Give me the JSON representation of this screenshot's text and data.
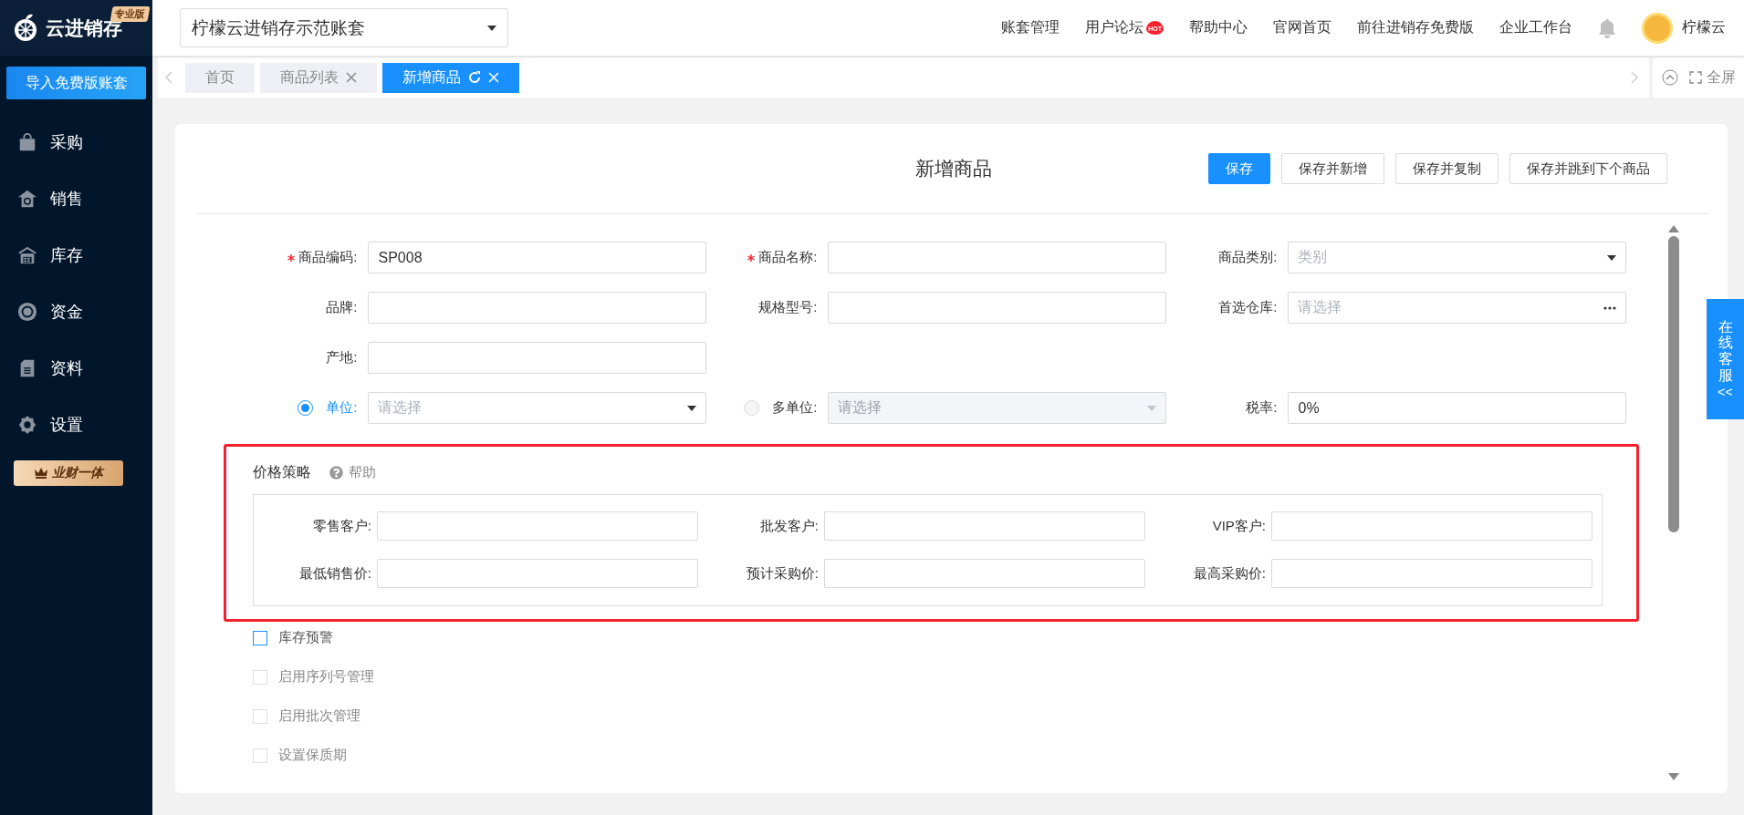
{
  "sidebar": {
    "logo": "云进销存",
    "edition": "专业版",
    "import_button": "导入免费版账套",
    "items": [
      {
        "label": "采购"
      },
      {
        "label": "销售"
      },
      {
        "label": "库存"
      },
      {
        "label": "资金"
      },
      {
        "label": "资料"
      },
      {
        "label": "设置"
      }
    ],
    "promo": "业财一体"
  },
  "header": {
    "account": "柠檬云进销存示范账套",
    "nav": [
      {
        "label": "账套管理"
      },
      {
        "label": "用户论坛",
        "badge": "HOT"
      },
      {
        "label": "帮助中心"
      },
      {
        "label": "官网首页"
      },
      {
        "label": "前往进销存免费版"
      },
      {
        "label": "企业工作台"
      }
    ],
    "user": "柠檬云"
  },
  "tabs": [
    {
      "label": "首页",
      "selected": false,
      "closable": false,
      "refreshable": false
    },
    {
      "label": "商品列表",
      "selected": false,
      "closable": true,
      "refreshable": false
    },
    {
      "label": "新增商品",
      "selected": true,
      "closable": true,
      "refreshable": true
    }
  ],
  "fullscreen": "全屏",
  "form": {
    "title": "新增商品",
    "buttons": [
      {
        "label": "保存",
        "primary": true
      },
      {
        "label": "保存并新增",
        "primary": false
      },
      {
        "label": "保存并复制",
        "primary": false
      },
      {
        "label": "保存并跳到下个商品",
        "primary": false
      }
    ],
    "rows": [
      [
        {
          "kind": "text",
          "label": "商品编码:",
          "required": true,
          "value": "SP008"
        },
        {
          "kind": "text",
          "label": "商品名称:",
          "required": true
        },
        {
          "kind": "select",
          "label": "商品类别:",
          "required": false,
          "placeholder": "类别"
        }
      ],
      [
        {
          "kind": "text",
          "label": "品牌:",
          "required": false
        },
        {
          "kind": "text",
          "label": "规格型号:",
          "required": false
        },
        {
          "kind": "picker",
          "label": "首选仓库:",
          "required": false,
          "placeholder": "请选择"
        }
      ],
      [
        {
          "kind": "text",
          "label": "产地:",
          "required": false
        }
      ],
      [
        {
          "kind": "radio",
          "label": "单位:",
          "selected": true,
          "disabled": false,
          "placeholder": "请选择"
        },
        {
          "kind": "radio",
          "label": "多单位:",
          "selected": false,
          "disabled": true,
          "placeholder": "请选择"
        },
        {
          "kind": "text",
          "label": "税率:",
          "required": false,
          "value": "0%"
        }
      ]
    ],
    "pricing": {
      "title": "价格策略",
      "help": "帮助",
      "fields": [
        {
          "label": "零售客户:"
        },
        {
          "label": "批发客户:"
        },
        {
          "label": "VIP客户:"
        },
        {
          "label": "最低销售价:"
        },
        {
          "label": "预计采购价:"
        },
        {
          "label": "最高采购价:"
        }
      ]
    },
    "options": [
      {
        "label": "库存预警",
        "checked": false,
        "disabled": false
      },
      {
        "label": "启用序列号管理",
        "checked": false,
        "disabled": true
      },
      {
        "label": "启用批次管理",
        "checked": false,
        "disabled": true
      },
      {
        "label": "设置保质期",
        "checked": false,
        "disabled": true
      }
    ]
  },
  "service_tab": {
    "text": "在线客服",
    "arrow": "<<"
  }
}
